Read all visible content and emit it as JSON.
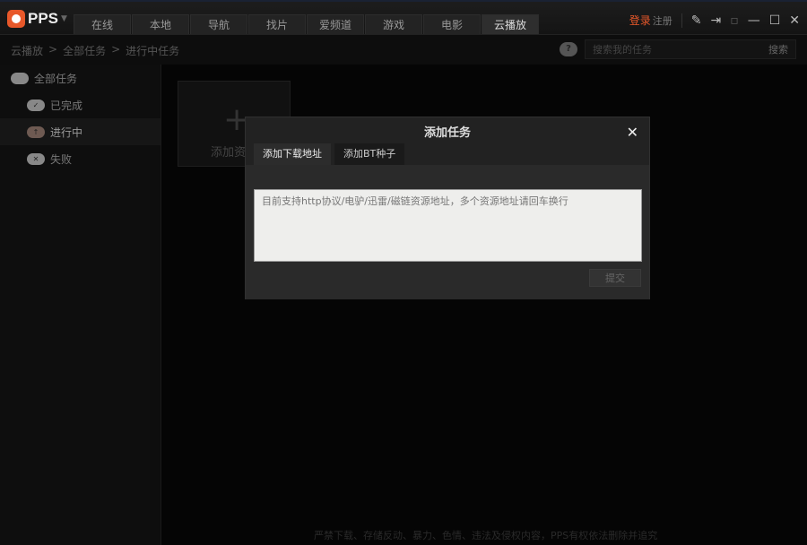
{
  "app": {
    "logo": "PPS"
  },
  "tabs": [
    "在线",
    "本地",
    "导航",
    "找片",
    "爱频道",
    "游戏",
    "电影",
    "云播放"
  ],
  "active_tab": 7,
  "topright": {
    "login": "登录",
    "register": "注册"
  },
  "breadcrumb": [
    "云播放",
    ">",
    "全部任务",
    ">",
    "进行中任务"
  ],
  "search": {
    "placeholder": "搜索我的任务",
    "button": "搜索"
  },
  "sidebar": [
    {
      "label": "全部任务",
      "icon": "cloud-icon"
    },
    {
      "label": "已完成",
      "icon": "cloud-check-icon"
    },
    {
      "label": "进行中",
      "icon": "cloud-upload-icon"
    },
    {
      "label": "失败",
      "icon": "cloud-x-icon"
    }
  ],
  "add_box": {
    "label": "添加资源"
  },
  "dialog": {
    "title": "添加任务",
    "tabs": [
      "添加下载地址",
      "添加BT种子"
    ],
    "placeholder": "目前支持http协议/电驴/迅雷/磁链资源地址，多个资源地址请回车换行",
    "submit": "提交"
  },
  "footer": "严禁下载、存储反动、暴力、色情、违法及侵权内容，PPS有权依法删除并追究",
  "colors": {
    "accent": "#e8582a"
  }
}
